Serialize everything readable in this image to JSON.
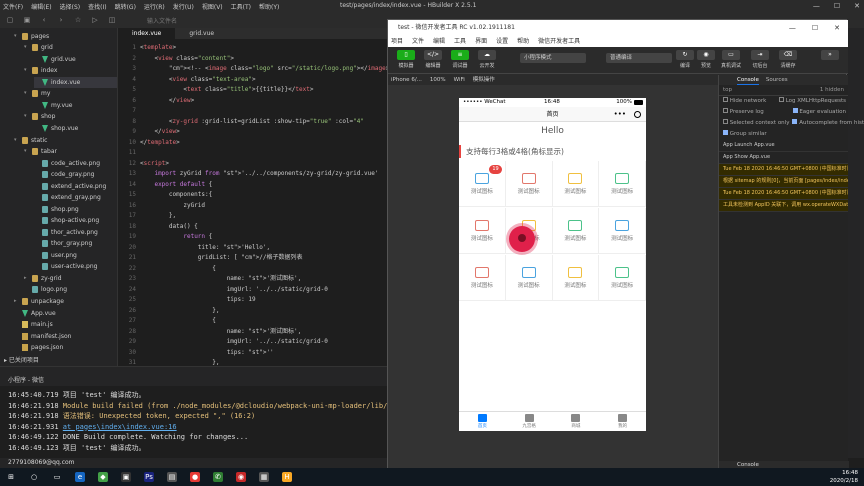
{
  "hbuilder": {
    "menu": [
      "文件(F)",
      "编辑(E)",
      "选择(S)",
      "查找(I)",
      "跳转(G)",
      "运行(R)",
      "发行(U)",
      "视图(V)",
      "工具(T)",
      "帮助(Y)"
    ],
    "window_title": "test/pages/index/index.vue - HBuilder X 2.5.1",
    "search_placeholder": "输入文件名",
    "tabs": [
      "index.vue",
      "grid.vue"
    ],
    "tree": [
      {
        "label": "pages",
        "type": "folder",
        "indent": 0,
        "open": true
      },
      {
        "label": "grid",
        "type": "folder",
        "indent": 1,
        "open": true
      },
      {
        "label": "grid.vue",
        "type": "vue",
        "indent": 2
      },
      {
        "label": "index",
        "type": "folder",
        "indent": 1,
        "open": true
      },
      {
        "label": "index.vue",
        "type": "vue",
        "indent": 2,
        "selected": true
      },
      {
        "label": "my",
        "type": "folder",
        "indent": 1,
        "open": true
      },
      {
        "label": "my.vue",
        "type": "vue",
        "indent": 2
      },
      {
        "label": "shop",
        "type": "folder",
        "indent": 1,
        "open": true
      },
      {
        "label": "shop.vue",
        "type": "vue",
        "indent": 2
      },
      {
        "label": "static",
        "type": "folder",
        "indent": 0,
        "open": true
      },
      {
        "label": "tabar",
        "type": "folder",
        "indent": 1,
        "open": true
      },
      {
        "label": "code_active.png",
        "type": "png",
        "indent": 2
      },
      {
        "label": "code_gray.png",
        "type": "png",
        "indent": 2
      },
      {
        "label": "extend_active.png",
        "type": "png",
        "indent": 2
      },
      {
        "label": "extend_gray.png",
        "type": "png",
        "indent": 2
      },
      {
        "label": "shop.png",
        "type": "png",
        "indent": 2
      },
      {
        "label": "shop-active.png",
        "type": "png",
        "indent": 2
      },
      {
        "label": "thor_active.png",
        "type": "png",
        "indent": 2
      },
      {
        "label": "thor_gray.png",
        "type": "png",
        "indent": 2
      },
      {
        "label": "user.png",
        "type": "png",
        "indent": 2
      },
      {
        "label": "user-active.png",
        "type": "png",
        "indent": 2
      },
      {
        "label": "zy-grid",
        "type": "folder",
        "indent": 1,
        "open": false
      },
      {
        "label": "logo.png",
        "type": "png",
        "indent": 1
      },
      {
        "label": "unpackage",
        "type": "folder",
        "indent": 0,
        "open": false
      },
      {
        "label": "App.vue",
        "type": "vue",
        "indent": 0
      },
      {
        "label": "main.js",
        "type": "js",
        "indent": 0
      },
      {
        "label": "manifest.json",
        "type": "json",
        "indent": 0
      },
      {
        "label": "pages.json",
        "type": "json",
        "indent": 0
      }
    ],
    "closed_dirs_label": "已关闭项目",
    "code": [
      "<template>",
      "    <view class=\"content\">",
      "        <!-- <image class=\"logo\" src=\"/static/logo.png\"></image> -->",
      "        <view class=\"text-area\">",
      "            <text class=\"title\">{{title}}</text>",
      "        </view>",
      "",
      "        <zy-grid :grid-list=gridList :show-tip=\"true\" :col=\"4\"",
      "    </view>",
      "</template>",
      "",
      "<script>",
      "    import zyGrid from '../../components/zy-grid/zy-grid.vue'",
      "    export default {",
      "        components:{",
      "            zyGrid",
      "        },",
      "        data() {",
      "            return {",
      "                title: 'Hello',",
      "                gridList: [ //格子数据列表",
      "                    {",
      "                        name: '测试图标',",
      "                        imgUrl: '../../static/grid-0",
      "                        tips: 19",
      "                    },",
      "                    {",
      "                        name: '测试图标',",
      "                        imgUrl: '../../static/grid-0",
      "                        tips: ''",
      "                    },",
      "                    {",
      "                        name: '测试图标',"
    ],
    "console_title": "小程序 - 微信",
    "console_lines": [
      {
        "time": "16:45:40.719",
        "text": "项目 'test' 编译成功。",
        "kind": "ok"
      },
      {
        "time": "16:46:21.918",
        "text": "Module build failed (from ./node_modules/@dcloudio/webpack-uni-mp-loader/lib/sc",
        "kind": "err"
      },
      {
        "time": "16:46:21.918",
        "text": "语法错误: Unexpected token, expected \",\" (16:2)",
        "kind": "err"
      },
      {
        "time": "16:46:21.931",
        "text": "    at pages\\index\\index.vue:16",
        "kind": "link"
      },
      {
        "time": "16:46:49.122",
        "text": "DONE  Build complete. Watching for changes...",
        "kind": "ok"
      },
      {
        "time": "16:46:49.123",
        "text": "项目 'test' 编译成功。",
        "kind": "ok"
      }
    ],
    "status_user": "2779108069@qq.com"
  },
  "devtools": {
    "title": "test - 微信开发者工具 RC v1.02.1911181",
    "menu": [
      "项目",
      "文件",
      "编辑",
      "工具",
      "界面",
      "设置",
      "帮助",
      "微信开发者工具"
    ],
    "toolbar": {
      "sim": "模拟器",
      "editor": "编辑器",
      "debug": "调试器",
      "cloud": "云开发",
      "mode": "小程序模式",
      "compile": "普通编译",
      "compile_btn": "编译",
      "preview": "预览",
      "real_debug": "真机调试",
      "bg": "切后台",
      "cache": "清缓存",
      "more": "详情"
    },
    "subbar": [
      "iPhone 6/...",
      "100%",
      "WiFi",
      "模拟操作"
    ],
    "phone": {
      "carrier": "•••••• WeChat",
      "time": "16:48",
      "battery": "100%",
      "nav_title": "首页",
      "hello": "Hello",
      "grid_title": "支持每行3格或4格(角标显示)",
      "grid": [
        {
          "label": "测试图标",
          "badge": "19",
          "color": "#4aa3df"
        },
        {
          "label": "测试图标",
          "badge": "",
          "color": "#e2776b"
        },
        {
          "label": "测试图标",
          "badge": "",
          "color": "#f0c040"
        },
        {
          "label": "测试图标",
          "badge": "",
          "color": "#4cc28a"
        },
        {
          "label": "测试图标",
          "badge": "",
          "color": "#e2776b"
        },
        {
          "label": "测试图标",
          "badge": "",
          "color": "#f0c040"
        },
        {
          "label": "测试图标",
          "badge": "",
          "color": "#4cc28a"
        },
        {
          "label": "测试图标",
          "badge": "",
          "color": "#4aa3df"
        },
        {
          "label": "测试图标",
          "badge": "",
          "color": "#e2776b"
        },
        {
          "label": "测试图标",
          "badge": "",
          "color": "#4aa3df"
        },
        {
          "label": "测试图标",
          "badge": "",
          "color": "#f0c040"
        },
        {
          "label": "测试图标",
          "badge": "",
          "color": "#4cc28a"
        }
      ],
      "tabbar": [
        "首页",
        "九宫格",
        "商城",
        "我的"
      ]
    },
    "console": {
      "tabs": [
        "Console",
        "Sources"
      ],
      "filter": "top",
      "hidden": "1 hidden",
      "options_left": [
        "Hide network",
        "Preserve log",
        "Selected context only",
        "Group similar"
      ],
      "options_right": [
        "Log XMLHttpRequests",
        "Eager evaluation",
        "Autocomplete from history"
      ],
      "logs": [
        {
          "text": "App Launch",
          "src": "App.vue",
          "kind": "info"
        },
        {
          "text": "App Show",
          "src": "App.vue",
          "kind": "info"
        },
        {
          "text": "Tue Feb 18 2020 16:46:50 GMT+0800 (中国标准时间) sitemap 索引情况提示",
          "src": "VM419:4",
          "kind": "warn"
        },
        {
          "text": "根据 sitemap 的规则[0]，当前页面 [pages/index/index] 将被索引",
          "src": "VM386:1",
          "kind": "warn"
        },
        {
          "text": "Tue Feb 18 2020 16:46:50 GMT+0800 (中国标准时间) 无 AppID 关联",
          "src": "VM386:1",
          "kind": "warn"
        },
        {
          "text": "工具未检测到 AppID 关联下，调用 wx.operateWXData 是受限的",
          "src": "VM386:1",
          "kind": "warn"
        }
      ],
      "drawer": "Console"
    }
  },
  "taskbar": {
    "time": "16:48",
    "date": "2020/2/18"
  }
}
